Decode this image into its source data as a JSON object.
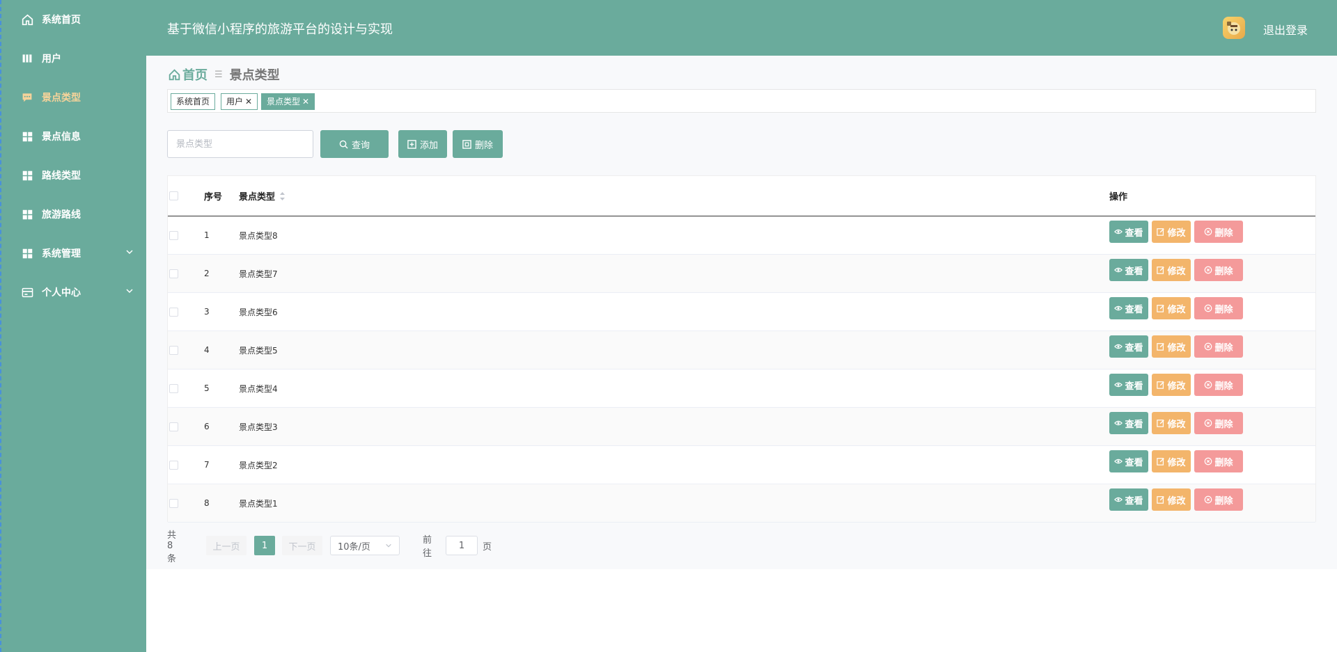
{
  "sidebar": {
    "items": [
      {
        "label": "系统首页",
        "icon": "home-icon"
      },
      {
        "label": "用户",
        "icon": "book-icon"
      },
      {
        "label": "景点类型",
        "icon": "chat-icon"
      },
      {
        "label": "景点信息",
        "icon": "grid-icon"
      },
      {
        "label": "路线类型",
        "icon": "grid-icon"
      },
      {
        "label": "旅游路线",
        "icon": "grid-icon"
      },
      {
        "label": "系统管理",
        "icon": "grid-icon"
      },
      {
        "label": "个人中心",
        "icon": "card-icon"
      }
    ]
  },
  "header": {
    "title": "基于微信小程序的旅游平台的设计与实现",
    "logout": "退出登录"
  },
  "breadcrumb": {
    "home": "首页",
    "current": "景点类型"
  },
  "tags": [
    "系统首页",
    "用户",
    "景点类型"
  ],
  "search": {
    "placeholder": "景点类型",
    "query_label": "查询",
    "add_label": "添加",
    "delete_label": "删除"
  },
  "table": {
    "headers": {
      "index": "序号",
      "type": "景点类型",
      "actions": "操作"
    },
    "rows": [
      {
        "index": "1",
        "type": "景点类型8"
      },
      {
        "index": "2",
        "type": "景点类型7"
      },
      {
        "index": "3",
        "type": "景点类型6"
      },
      {
        "index": "4",
        "type": "景点类型5"
      },
      {
        "index": "5",
        "type": "景点类型4"
      },
      {
        "index": "6",
        "type": "景点类型3"
      },
      {
        "index": "7",
        "type": "景点类型2"
      },
      {
        "index": "8",
        "type": "景点类型1"
      }
    ],
    "actions": {
      "view": "查看",
      "edit": "修改",
      "delete": "删除"
    }
  },
  "pagination": {
    "total": "共 8 条",
    "prev": "上一页",
    "current": "1",
    "next": "下一页",
    "page_size": "10条/页",
    "goto": "前往",
    "goto_value": "1",
    "page_unit": "页"
  },
  "colors": {
    "primary": "#6aab9c",
    "warning": "#f3b56b",
    "danger": "#f49a9a",
    "active_menu": "#f6d39a"
  }
}
